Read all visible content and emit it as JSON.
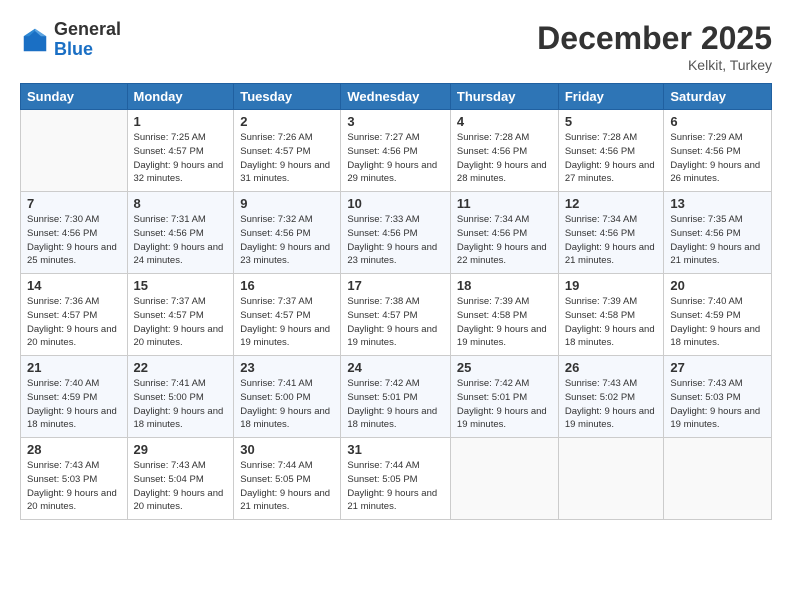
{
  "header": {
    "logo_general": "General",
    "logo_blue": "Blue",
    "month_year": "December 2025",
    "location": "Kelkit, Turkey"
  },
  "days_of_week": [
    "Sunday",
    "Monday",
    "Tuesday",
    "Wednesday",
    "Thursday",
    "Friday",
    "Saturday"
  ],
  "weeks": [
    [
      {
        "day": "",
        "sunrise": "",
        "sunset": "",
        "daylight": ""
      },
      {
        "day": "1",
        "sunrise": "Sunrise: 7:25 AM",
        "sunset": "Sunset: 4:57 PM",
        "daylight": "Daylight: 9 hours and 32 minutes."
      },
      {
        "day": "2",
        "sunrise": "Sunrise: 7:26 AM",
        "sunset": "Sunset: 4:57 PM",
        "daylight": "Daylight: 9 hours and 31 minutes."
      },
      {
        "day": "3",
        "sunrise": "Sunrise: 7:27 AM",
        "sunset": "Sunset: 4:56 PM",
        "daylight": "Daylight: 9 hours and 29 minutes."
      },
      {
        "day": "4",
        "sunrise": "Sunrise: 7:28 AM",
        "sunset": "Sunset: 4:56 PM",
        "daylight": "Daylight: 9 hours and 28 minutes."
      },
      {
        "day": "5",
        "sunrise": "Sunrise: 7:28 AM",
        "sunset": "Sunset: 4:56 PM",
        "daylight": "Daylight: 9 hours and 27 minutes."
      },
      {
        "day": "6",
        "sunrise": "Sunrise: 7:29 AM",
        "sunset": "Sunset: 4:56 PM",
        "daylight": "Daylight: 9 hours and 26 minutes."
      }
    ],
    [
      {
        "day": "7",
        "sunrise": "Sunrise: 7:30 AM",
        "sunset": "Sunset: 4:56 PM",
        "daylight": "Daylight: 9 hours and 25 minutes."
      },
      {
        "day": "8",
        "sunrise": "Sunrise: 7:31 AM",
        "sunset": "Sunset: 4:56 PM",
        "daylight": "Daylight: 9 hours and 24 minutes."
      },
      {
        "day": "9",
        "sunrise": "Sunrise: 7:32 AM",
        "sunset": "Sunset: 4:56 PM",
        "daylight": "Daylight: 9 hours and 23 minutes."
      },
      {
        "day": "10",
        "sunrise": "Sunrise: 7:33 AM",
        "sunset": "Sunset: 4:56 PM",
        "daylight": "Daylight: 9 hours and 23 minutes."
      },
      {
        "day": "11",
        "sunrise": "Sunrise: 7:34 AM",
        "sunset": "Sunset: 4:56 PM",
        "daylight": "Daylight: 9 hours and 22 minutes."
      },
      {
        "day": "12",
        "sunrise": "Sunrise: 7:34 AM",
        "sunset": "Sunset: 4:56 PM",
        "daylight": "Daylight: 9 hours and 21 minutes."
      },
      {
        "day": "13",
        "sunrise": "Sunrise: 7:35 AM",
        "sunset": "Sunset: 4:56 PM",
        "daylight": "Daylight: 9 hours and 21 minutes."
      }
    ],
    [
      {
        "day": "14",
        "sunrise": "Sunrise: 7:36 AM",
        "sunset": "Sunset: 4:57 PM",
        "daylight": "Daylight: 9 hours and 20 minutes."
      },
      {
        "day": "15",
        "sunrise": "Sunrise: 7:37 AM",
        "sunset": "Sunset: 4:57 PM",
        "daylight": "Daylight: 9 hours and 20 minutes."
      },
      {
        "day": "16",
        "sunrise": "Sunrise: 7:37 AM",
        "sunset": "Sunset: 4:57 PM",
        "daylight": "Daylight: 9 hours and 19 minutes."
      },
      {
        "day": "17",
        "sunrise": "Sunrise: 7:38 AM",
        "sunset": "Sunset: 4:57 PM",
        "daylight": "Daylight: 9 hours and 19 minutes."
      },
      {
        "day": "18",
        "sunrise": "Sunrise: 7:39 AM",
        "sunset": "Sunset: 4:58 PM",
        "daylight": "Daylight: 9 hours and 19 minutes."
      },
      {
        "day": "19",
        "sunrise": "Sunrise: 7:39 AM",
        "sunset": "Sunset: 4:58 PM",
        "daylight": "Daylight: 9 hours and 18 minutes."
      },
      {
        "day": "20",
        "sunrise": "Sunrise: 7:40 AM",
        "sunset": "Sunset: 4:59 PM",
        "daylight": "Daylight: 9 hours and 18 minutes."
      }
    ],
    [
      {
        "day": "21",
        "sunrise": "Sunrise: 7:40 AM",
        "sunset": "Sunset: 4:59 PM",
        "daylight": "Daylight: 9 hours and 18 minutes."
      },
      {
        "day": "22",
        "sunrise": "Sunrise: 7:41 AM",
        "sunset": "Sunset: 5:00 PM",
        "daylight": "Daylight: 9 hours and 18 minutes."
      },
      {
        "day": "23",
        "sunrise": "Sunrise: 7:41 AM",
        "sunset": "Sunset: 5:00 PM",
        "daylight": "Daylight: 9 hours and 18 minutes."
      },
      {
        "day": "24",
        "sunrise": "Sunrise: 7:42 AM",
        "sunset": "Sunset: 5:01 PM",
        "daylight": "Daylight: 9 hours and 18 minutes."
      },
      {
        "day": "25",
        "sunrise": "Sunrise: 7:42 AM",
        "sunset": "Sunset: 5:01 PM",
        "daylight": "Daylight: 9 hours and 19 minutes."
      },
      {
        "day": "26",
        "sunrise": "Sunrise: 7:43 AM",
        "sunset": "Sunset: 5:02 PM",
        "daylight": "Daylight: 9 hours and 19 minutes."
      },
      {
        "day": "27",
        "sunrise": "Sunrise: 7:43 AM",
        "sunset": "Sunset: 5:03 PM",
        "daylight": "Daylight: 9 hours and 19 minutes."
      }
    ],
    [
      {
        "day": "28",
        "sunrise": "Sunrise: 7:43 AM",
        "sunset": "Sunset: 5:03 PM",
        "daylight": "Daylight: 9 hours and 20 minutes."
      },
      {
        "day": "29",
        "sunrise": "Sunrise: 7:43 AM",
        "sunset": "Sunset: 5:04 PM",
        "daylight": "Daylight: 9 hours and 20 minutes."
      },
      {
        "day": "30",
        "sunrise": "Sunrise: 7:44 AM",
        "sunset": "Sunset: 5:05 PM",
        "daylight": "Daylight: 9 hours and 21 minutes."
      },
      {
        "day": "31",
        "sunrise": "Sunrise: 7:44 AM",
        "sunset": "Sunset: 5:05 PM",
        "daylight": "Daylight: 9 hours and 21 minutes."
      },
      {
        "day": "",
        "sunrise": "",
        "sunset": "",
        "daylight": ""
      },
      {
        "day": "",
        "sunrise": "",
        "sunset": "",
        "daylight": ""
      },
      {
        "day": "",
        "sunrise": "",
        "sunset": "",
        "daylight": ""
      }
    ]
  ]
}
